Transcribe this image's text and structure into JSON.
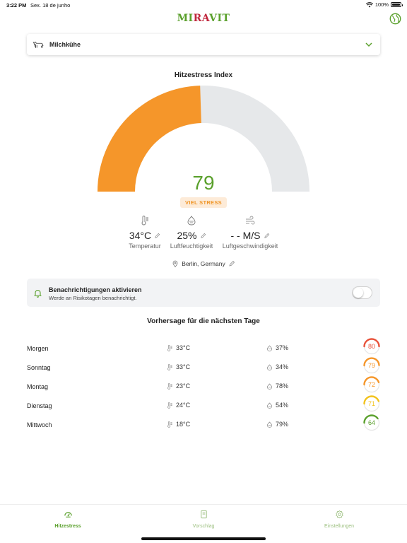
{
  "status_bar": {
    "time": "3:22 PM",
    "date": "Sex. 18 de junho",
    "battery": "100%"
  },
  "app": {
    "logo_part1": "MI",
    "logo_part2": "RA",
    "logo_part3": "VIT"
  },
  "animal_select": {
    "value": "Milchkühe"
  },
  "gauge": {
    "title": "Hitzestress Index",
    "value": "79",
    "max": 100,
    "level_label": "VIEL STRESS",
    "fill_color": "#f5962a",
    "track_color": "#e6e8ea"
  },
  "metrics": [
    {
      "value": "34°C",
      "label": "Temperatur"
    },
    {
      "value": "25%",
      "label": "Luftfeuchtigkeit"
    },
    {
      "value": "- - M/S",
      "label": "Luftgeschwindigkeit"
    }
  ],
  "location": {
    "text": "Berlin, Germany"
  },
  "notifications": {
    "title": "Benachrichtigungen aktivieren",
    "subtitle": "Werde an Risikotagen benachrichtigt.",
    "enabled": false
  },
  "forecast": {
    "title": "Vorhersage für die nächsten Tage",
    "rows": [
      {
        "day": "Morgen",
        "temp": "33°C",
        "humidity": "37%",
        "score": "80",
        "color": "#e8523a"
      },
      {
        "day": "Sonntag",
        "temp": "33°C",
        "humidity": "34%",
        "score": "79",
        "color": "#f5962a"
      },
      {
        "day": "Montag",
        "temp": "23°C",
        "humidity": "78%",
        "score": "72",
        "color": "#f5962a"
      },
      {
        "day": "Dienstag",
        "temp": "24°C",
        "humidity": "54%",
        "score": "71",
        "color": "#f2c21b"
      },
      {
        "day": "Mittwoch",
        "temp": "18°C",
        "humidity": "79%",
        "score": "64",
        "color": "#5aa02c"
      }
    ]
  },
  "tabs": [
    {
      "label": "Hitzestress",
      "icon": "gauge-icon",
      "active": true
    },
    {
      "label": "Vorschlag",
      "icon": "book-icon",
      "active": false
    },
    {
      "label": "Einstellungen",
      "icon": "gear-icon",
      "active": false
    }
  ]
}
